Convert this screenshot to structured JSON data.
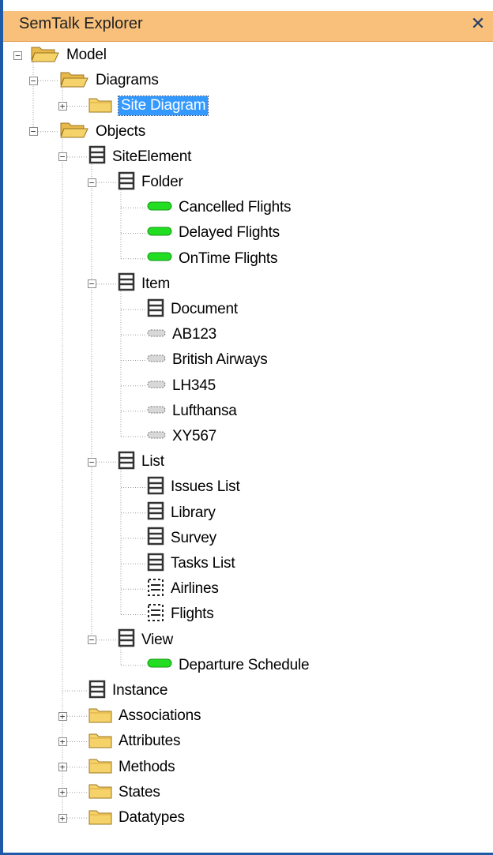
{
  "window": {
    "title": "SemTalk Explorer",
    "close_glyph": "✕"
  },
  "tree": [
    {
      "label": "Model",
      "icon": "folder-open",
      "depth": 0,
      "toggle": "minus"
    },
    {
      "label": "Diagrams",
      "icon": "folder-open",
      "depth": 1,
      "toggle": "minus"
    },
    {
      "label": "Site Diagram",
      "icon": "folder-closed",
      "depth": 2,
      "toggle": "plus",
      "selected": true
    },
    {
      "label": "Objects",
      "icon": "folder-open",
      "depth": 1,
      "toggle": "minus"
    },
    {
      "label": "SiteElement",
      "icon": "class",
      "depth": 2,
      "toggle": "minus"
    },
    {
      "label": "Folder",
      "icon": "class",
      "depth": 3,
      "toggle": "minus"
    },
    {
      "label": "Cancelled Flights",
      "icon": "instance-green",
      "depth": 4
    },
    {
      "label": "Delayed Flights",
      "icon": "instance-green",
      "depth": 4
    },
    {
      "label": "OnTime Flights",
      "icon": "instance-green",
      "depth": 4
    },
    {
      "label": "Item",
      "icon": "class",
      "depth": 3,
      "toggle": "minus"
    },
    {
      "label": "Document",
      "icon": "class",
      "depth": 4
    },
    {
      "label": "AB123",
      "icon": "instance-gray",
      "depth": 4
    },
    {
      "label": "British Airways",
      "icon": "instance-gray",
      "depth": 4
    },
    {
      "label": "LH345",
      "icon": "instance-gray",
      "depth": 4
    },
    {
      "label": "Lufthansa",
      "icon": "instance-gray",
      "depth": 4
    },
    {
      "label": "XY567",
      "icon": "instance-gray",
      "depth": 4
    },
    {
      "label": "List",
      "icon": "class",
      "depth": 3,
      "toggle": "minus"
    },
    {
      "label": "Issues List",
      "icon": "class",
      "depth": 4
    },
    {
      "label": "Library",
      "icon": "class",
      "depth": 4
    },
    {
      "label": "Survey",
      "icon": "class",
      "depth": 4
    },
    {
      "label": "Tasks List",
      "icon": "class",
      "depth": 4
    },
    {
      "label": "Airlines",
      "icon": "class-dashed",
      "depth": 4
    },
    {
      "label": "Flights",
      "icon": "class-dashed",
      "depth": 4
    },
    {
      "label": "View",
      "icon": "class",
      "depth": 3,
      "toggle": "minus"
    },
    {
      "label": "Departure Schedule",
      "icon": "instance-green",
      "depth": 4
    },
    {
      "label": "Instance",
      "icon": "class",
      "depth": 2
    },
    {
      "label": "Associations",
      "icon": "folder-closed",
      "depth": 2,
      "toggle": "plus"
    },
    {
      "label": "Attributes",
      "icon": "folder-closed",
      "depth": 2,
      "toggle": "plus"
    },
    {
      "label": "Methods",
      "icon": "folder-closed",
      "depth": 2,
      "toggle": "plus"
    },
    {
      "label": "States",
      "icon": "folder-closed",
      "depth": 2,
      "toggle": "plus"
    },
    {
      "label": "Datatypes",
      "icon": "folder-closed",
      "depth": 2,
      "toggle": "plus"
    }
  ],
  "colors": {
    "title_bar": "#f8c07a",
    "selection": "#3399ff",
    "frame_border": "#1f5aa8",
    "instance_green": "#22dd22",
    "folder_yellow": "#f6d36a"
  }
}
